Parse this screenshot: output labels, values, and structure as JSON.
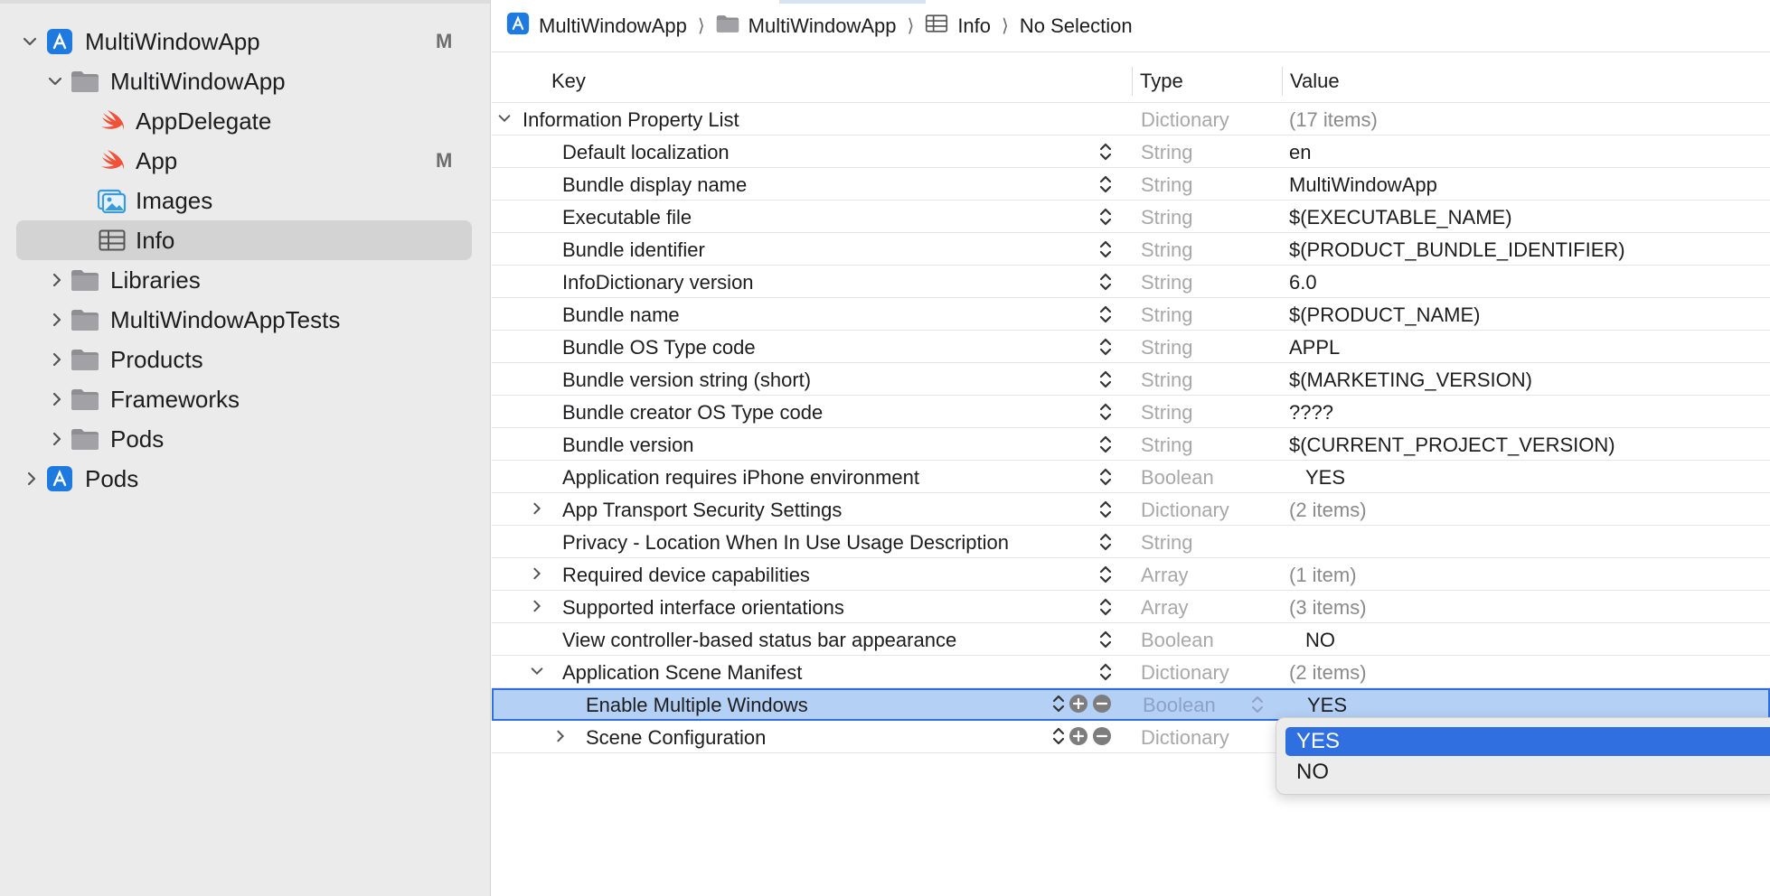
{
  "sidebar": {
    "items": [
      {
        "label": "MultiWindowApp",
        "badge": "M",
        "icon": "xcode-project-icon",
        "expanded": true
      },
      {
        "label": "MultiWindowApp",
        "badge": "",
        "icon": "folder-icon",
        "expanded": true
      },
      {
        "label": "AppDelegate",
        "badge": "",
        "icon": "swift-file-icon"
      },
      {
        "label": "App",
        "badge": "M",
        "icon": "swift-file-icon"
      },
      {
        "label": "Images",
        "badge": "",
        "icon": "asset-catalog-icon"
      },
      {
        "label": "Info",
        "badge": "",
        "icon": "plist-table-icon",
        "selected": true
      },
      {
        "label": "Libraries",
        "badge": "",
        "icon": "folder-icon",
        "expanded": false
      },
      {
        "label": "MultiWindowAppTests",
        "badge": "",
        "icon": "folder-icon",
        "expanded": false
      },
      {
        "label": "Products",
        "badge": "",
        "icon": "folder-icon",
        "expanded": false
      },
      {
        "label": "Frameworks",
        "badge": "",
        "icon": "folder-icon",
        "expanded": false
      },
      {
        "label": "Pods",
        "badge": "",
        "icon": "folder-icon",
        "expanded": false
      },
      {
        "label": "Pods",
        "badge": "",
        "icon": "xcode-project-icon",
        "expanded": false
      }
    ]
  },
  "breadcrumb": {
    "items": [
      "MultiWindowApp",
      "MultiWindowApp",
      "Info",
      "No Selection"
    ]
  },
  "table": {
    "headers": {
      "key": "Key",
      "type": "Type",
      "value": "Value"
    },
    "rows": [
      {
        "key": "Information Property List",
        "type": "Dictionary",
        "value": "(17 items)"
      },
      {
        "key": "Default localization",
        "type": "String",
        "value": "en"
      },
      {
        "key": "Bundle display name",
        "type": "String",
        "value": "MultiWindowApp"
      },
      {
        "key": "Executable file",
        "type": "String",
        "value": "$(EXECUTABLE_NAME)"
      },
      {
        "key": "Bundle identifier",
        "type": "String",
        "value": "$(PRODUCT_BUNDLE_IDENTIFIER)"
      },
      {
        "key": "InfoDictionary version",
        "type": "String",
        "value": "6.0"
      },
      {
        "key": "Bundle name",
        "type": "String",
        "value": "$(PRODUCT_NAME)"
      },
      {
        "key": "Bundle OS Type code",
        "type": "String",
        "value": "APPL"
      },
      {
        "key": "Bundle version string (short)",
        "type": "String",
        "value": "$(MARKETING_VERSION)"
      },
      {
        "key": "Bundle creator OS Type code",
        "type": "String",
        "value": "????"
      },
      {
        "key": "Bundle version",
        "type": "String",
        "value": "$(CURRENT_PROJECT_VERSION)"
      },
      {
        "key": "Application requires iPhone environment",
        "type": "Boolean",
        "value": "YES"
      },
      {
        "key": "App Transport Security Settings",
        "type": "Dictionary",
        "value": "(2 items)"
      },
      {
        "key": "Privacy - Location When In Use Usage Description",
        "type": "String",
        "value": ""
      },
      {
        "key": "Required device capabilities",
        "type": "Array",
        "value": "(1 item)"
      },
      {
        "key": "Supported interface orientations",
        "type": "Array",
        "value": "(3 items)"
      },
      {
        "key": "View controller-based status bar appearance",
        "type": "Boolean",
        "value": "NO"
      },
      {
        "key": "Application Scene Manifest",
        "type": "Dictionary",
        "value": "(2 items)"
      },
      {
        "key": "Enable Multiple Windows",
        "type": "Boolean",
        "value": "YES"
      },
      {
        "key": "Scene Configuration",
        "type": "Dictionary",
        "value": ""
      }
    ]
  },
  "dropdown": {
    "options": [
      "YES",
      "NO"
    ],
    "selected": "YES"
  },
  "colors": {
    "accent": "#2f6fdf",
    "selection_row": "#b4d0f5",
    "sidebar_bg": "#ebebeb",
    "swift_orange": "#f05138",
    "xcode_blue": "#1f7ae0"
  }
}
